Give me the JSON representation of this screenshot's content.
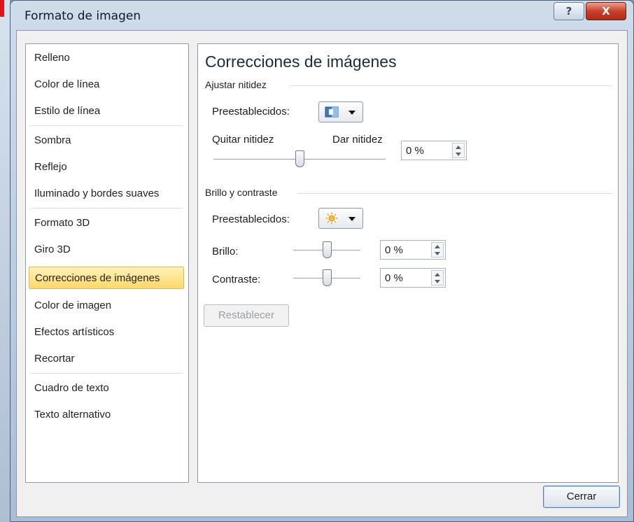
{
  "window": {
    "title": "Formato de imagen",
    "help_label": "?",
    "close_label": "X"
  },
  "nav": {
    "items": [
      {
        "label": "Relleno"
      },
      {
        "label": "Color de línea"
      },
      {
        "label": "Estilo de línea"
      },
      {
        "label": "Sombra"
      },
      {
        "label": "Reflejo"
      },
      {
        "label": "Iluminado y bordes suaves"
      },
      {
        "label": "Formato 3D"
      },
      {
        "label": "Giro 3D"
      },
      {
        "label": "Correcciones de imágenes"
      },
      {
        "label": "Color de imagen"
      },
      {
        "label": "Efectos artísticos"
      },
      {
        "label": "Recortar"
      },
      {
        "label": "Cuadro de texto"
      },
      {
        "label": "Texto alternativo"
      }
    ],
    "selected": "Correcciones de imágenes",
    "selected_color": "#fdd86a"
  },
  "panel": {
    "heading": "Correcciones de imágenes",
    "sharpen": {
      "group_label": "Ajustar nitidez",
      "presets_label": "Preestablecidos:",
      "presets_icon": "sharpen-preset-icon",
      "soften_label": "Quitar nitidez",
      "sharpen_label": "Dar nitidez",
      "value": "0 %",
      "slider_level": 0.5
    },
    "brightness_contrast": {
      "group_label": "Brillo y contraste",
      "presets_label": "Preestablecidos:",
      "presets_icon": "sun-preset-icon",
      "brightness_label": "Brillo:",
      "brightness_value": "0 %",
      "brightness_level": 0.5,
      "contrast_label": "Contraste:",
      "contrast_value": "0 %",
      "contrast_level": 0.5
    },
    "reset_label": "Restablecer"
  },
  "footer": {
    "close_label": "Cerrar"
  }
}
